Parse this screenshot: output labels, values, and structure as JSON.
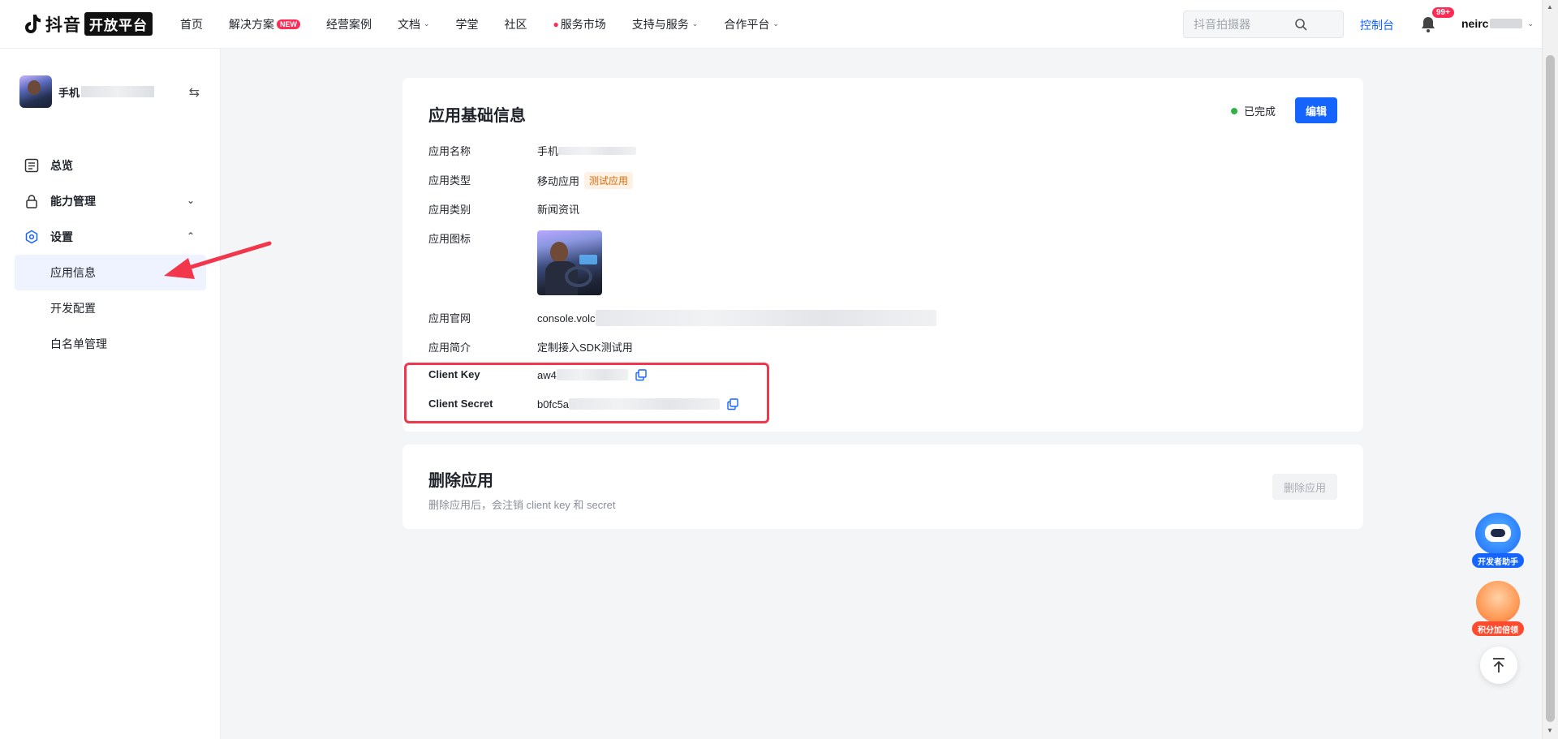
{
  "brand": {
    "name": "抖音",
    "badge": "开放平台"
  },
  "nav": {
    "items": [
      {
        "label": "首页"
      },
      {
        "label": "解决方案",
        "badge": "NEW"
      },
      {
        "label": "经营案例"
      },
      {
        "label": "文档",
        "caret": true
      },
      {
        "label": "学堂"
      },
      {
        "label": "社区"
      },
      {
        "label": "服务市场",
        "fire": true
      },
      {
        "label": "支持与服务",
        "caret": true
      },
      {
        "label": "合作平台",
        "caret": true
      }
    ],
    "search_placeholder": "抖音拍摄器",
    "console_label": "控制台",
    "notification_count": "99+",
    "username": "neirc"
  },
  "sidebar": {
    "app_name": "手机",
    "menu": {
      "overview": "总览",
      "capability": "能力管理",
      "settings": "设置"
    },
    "submenu": {
      "app_info": "应用信息",
      "dev_config": "开发配置",
      "whitelist": "白名单管理"
    }
  },
  "info_card": {
    "title": "应用基础信息",
    "status": "已完成",
    "edit_label": "编辑",
    "fields": {
      "name_label": "应用名称",
      "name_value": "手机",
      "type_label": "应用类型",
      "type_value": "移动应用",
      "type_tag": "测试应用",
      "category_label": "应用类别",
      "category_value": "新闻资讯",
      "icon_label": "应用图标",
      "website_label": "应用官网",
      "website_value": "console.volc",
      "intro_label": "应用简介",
      "intro_value": "定制接入SDK测试用",
      "client_key_label": "Client Key",
      "client_key_value": "aw4",
      "client_secret_label": "Client Secret",
      "client_secret_value": "b0fc5a"
    }
  },
  "delete_card": {
    "title": "删除应用",
    "description": "删除应用后，会注销 client key 和 secret",
    "button_label": "删除应用"
  },
  "floating": {
    "assistant_label": "开发者助手",
    "points_label": "积分加倍领"
  },
  "colors": {
    "primary": "#1664ff",
    "danger": "#fe2c55",
    "annotation": "#f2364b",
    "success": "#2fb344"
  }
}
